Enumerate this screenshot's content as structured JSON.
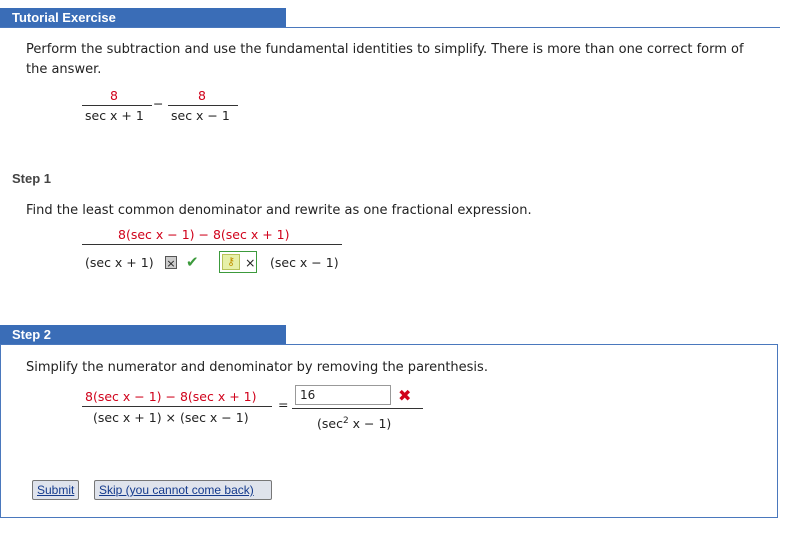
{
  "header": {
    "title": "Tutorial Exercise"
  },
  "problem": {
    "instructions_line1": "Perform the subtraction and use the fundamental identities to simplify. There is more than one correct form of",
    "instructions_line2": "the answer.",
    "frac1": {
      "numerator": "8",
      "denominator": "sec x + 1"
    },
    "operator": "−",
    "frac2": {
      "numerator": "8",
      "denominator": "sec x − 1"
    }
  },
  "step1": {
    "label": "Step 1",
    "instructions": "Find the least common denominator and rewrite as one fractional expression.",
    "numerator": "8(sec x − 1) − 8(sec x + 1)",
    "denom_left": "(sec x + 1)",
    "times_box": "×",
    "check": "✔",
    "denom_right_times": "×",
    "denom_right": "(sec x − 1)",
    "key_icon": "key-icon"
  },
  "step2": {
    "label": "Step 2",
    "instructions": "Simplify the numerator and denominator by removing the parenthesis.",
    "lhs_numerator": "8(sec x − 1) − 8(sec x + 1)",
    "lhs_denominator": "(sec x + 1) × (sec x − 1)",
    "equals": "=",
    "answer_input_value": "16",
    "wrong_mark": "✖",
    "rhs_denominator_prefix": "(sec",
    "rhs_denominator_exp": "2",
    "rhs_denominator_suffix": " x − 1)"
  },
  "buttons": {
    "submit": "Submit",
    "skip": "Skip (you cannot come back)"
  },
  "colors": {
    "accent": "#3a6db7",
    "error": "#d0021b",
    "correct": "#3c9a3c"
  }
}
